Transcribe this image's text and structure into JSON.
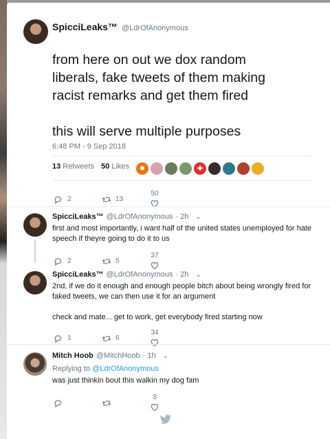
{
  "main_tweet": {
    "name": "SpicciLeaks™",
    "handle": "@LdrOfAnonymous",
    "text_line1": "from here on out we dox random",
    "text_line2": "liberals, fake tweets of them making",
    "text_line3": "racist remarks and get them fired",
    "text_line4": "this will serve multiple purposes",
    "timestamp": "6:48 PM - 9 Sep 2018",
    "retweets_count": "13",
    "retweets_label": "Retweets",
    "likes_count": "50",
    "likes_label": "Likes",
    "actions": {
      "replies": "2",
      "retweets": "13",
      "likes": "50"
    }
  },
  "replies": [
    {
      "name": "SpicciLeaks™",
      "handle": "@LdrOfAnonymous",
      "time": "· 2h",
      "text": "first and most importantly, i want half of the united states unemployed for hate speech if theyre going to do it to us",
      "actions": {
        "replies": "2",
        "retweets": "5",
        "likes": "37"
      }
    },
    {
      "name": "SpicciLeaks™",
      "handle": "@LdrOfAnonymous",
      "time": "· 2h",
      "text": "2nd, if we do it enough and enough people bitch about being wrongly fired for faked tweets, we can then use it for an argument",
      "text2": "check and mate... get to work, get everybody fired starting now",
      "actions": {
        "replies": "1",
        "retweets": "6",
        "likes": "34"
      }
    },
    {
      "name": "Mitch Hoob",
      "handle": "@MitchHoob",
      "time": "· 1h",
      "replying_prefix": "Replying to",
      "replying_to": "@LdrOfAnonymous",
      "text": "was just thinkin bout this walkin my dog fam",
      "actions": {
        "replies": "",
        "retweets": "",
        "likes": "3"
      }
    }
  ],
  "colors": {
    "accent": "#1da1f2",
    "secondary_text": "#657786",
    "divider": "#e6ecf0"
  }
}
